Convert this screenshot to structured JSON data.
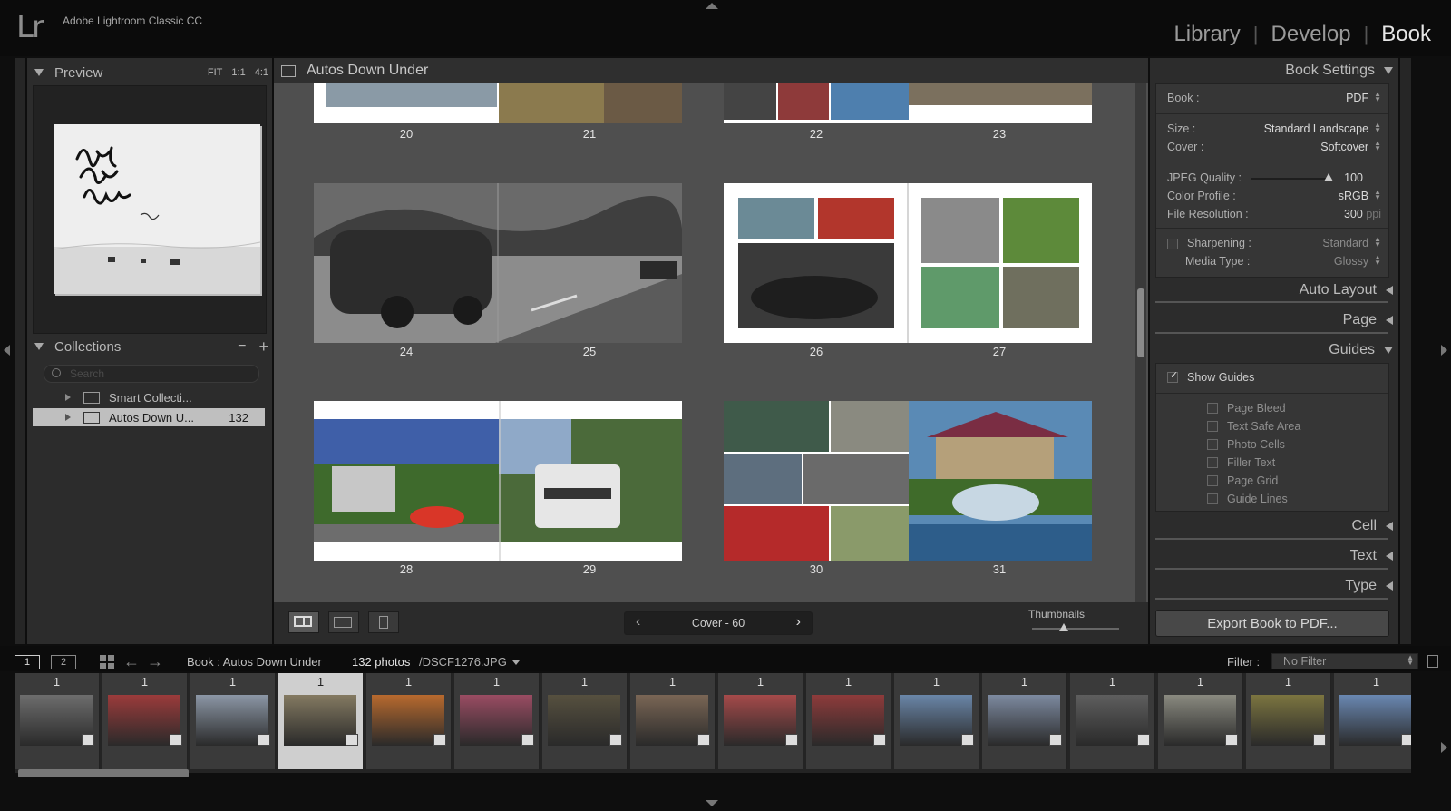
{
  "app": {
    "logo": "Lr",
    "title": "Adobe Lightroom Classic CC"
  },
  "modules": {
    "library": "Library",
    "develop": "Develop",
    "book": "Book",
    "separator": "|"
  },
  "left_panel": {
    "preview": {
      "title": "Preview",
      "zoom_fit": "FIT",
      "zoom_1_1": "1:1",
      "zoom_4_1": "4:1"
    },
    "collections": {
      "title": "Collections",
      "minus": "−",
      "plus": "+",
      "search_placeholder": "Search",
      "items": [
        {
          "label": "Smart Collecti...",
          "count": ""
        },
        {
          "label": "Autos Down U...",
          "count": "132"
        }
      ]
    }
  },
  "center": {
    "title": "Autos Down Under",
    "page_numbers": [
      "20",
      "21",
      "22",
      "23",
      "24",
      "25",
      "26",
      "27",
      "28",
      "29",
      "30",
      "31"
    ],
    "page_nav": {
      "label": "Cover - 60",
      "prev": "‹",
      "next": "›"
    },
    "thumbnails_label": "Thumbnails"
  },
  "right_panel": {
    "book_settings": {
      "title": "Book Settings",
      "book_label": "Book :",
      "book_value": "PDF",
      "size_label": "Size :",
      "size_value": "Standard Landscape",
      "cover_label": "Cover :",
      "cover_value": "Softcover",
      "jpeg_label": "JPEG Quality :",
      "jpeg_value": "100",
      "jpeg_level": 1.0,
      "profile_label": "Color Profile :",
      "profile_value": "sRGB",
      "resolution_label": "File Resolution :",
      "resolution_value": "300",
      "resolution_unit": "ppi",
      "sharpening_label": "Sharpening :",
      "sharpening_value": "Standard",
      "media_label": "Media Type :",
      "media_value": "Glossy"
    },
    "auto_layout": "Auto Layout",
    "page": "Page",
    "guides": {
      "title": "Guides",
      "show_guides": "Show Guides",
      "items": [
        "Page Bleed",
        "Text Safe Area",
        "Photo Cells",
        "Filler Text",
        "Page Grid",
        "Guide Lines"
      ]
    },
    "cell": "Cell",
    "text": "Text",
    "type": "Type",
    "export_button": "Export Book to PDF..."
  },
  "film_toolbar": {
    "screen1": "1",
    "screen2": "2",
    "source": "Book : Autos Down Under",
    "photo_count": "132 photos",
    "file": "/DSCF1276.JPG",
    "filter_label": "Filter :",
    "filter_value": "No Filter"
  },
  "filmstrip": {
    "cells": [
      {
        "count": "1",
        "color": "#6d6d6d"
      },
      {
        "count": "1",
        "color": "#9b3b3b"
      },
      {
        "count": "1",
        "color": "#8c97a6"
      },
      {
        "count": "1",
        "color": "#847a62"
      },
      {
        "count": "1",
        "color": "#b86a2e"
      },
      {
        "count": "1",
        "color": "#9a4c63"
      },
      {
        "count": "1",
        "color": "#56503f"
      },
      {
        "count": "1",
        "color": "#7a6655"
      },
      {
        "count": "1",
        "color": "#a54a4a"
      },
      {
        "count": "1",
        "color": "#8e3b3b"
      },
      {
        "count": "1",
        "color": "#6a86a8"
      },
      {
        "count": "1",
        "color": "#7d8aa0"
      },
      {
        "count": "1",
        "color": "#5e5e5e"
      },
      {
        "count": "1",
        "color": "#8a8a80"
      },
      {
        "count": "1",
        "color": "#7c7540"
      },
      {
        "count": "1",
        "color": "#6a88b2"
      }
    ]
  },
  "colors": {
    "panel": "#2c2c2c",
    "center_bg": "#4f4f4f",
    "active_module": "#e6e6e6"
  }
}
